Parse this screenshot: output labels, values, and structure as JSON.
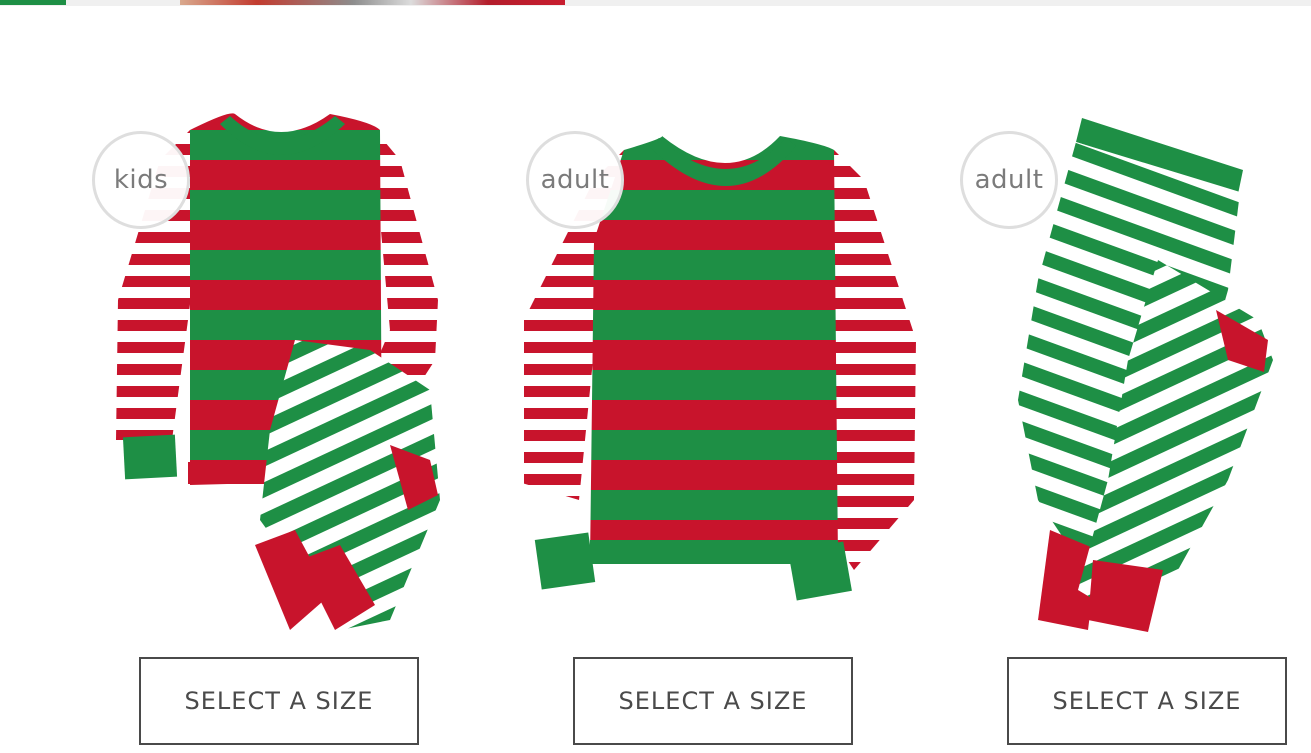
{
  "colors": {
    "green": "#1e8f45",
    "red": "#c8142c",
    "white": "#ffffff",
    "badge_text": "#7b7b7b",
    "button_border": "#4a4a4a"
  },
  "products": [
    {
      "badge": "kids",
      "garment": "kids pajama set (striped top and pants)",
      "button_label": "SELECT A SIZE"
    },
    {
      "badge": "adult",
      "garment": "adult striped pajama top",
      "button_label": "SELECT A SIZE"
    },
    {
      "badge": "adult",
      "garment": "adult striped pajama pants",
      "button_label": "SELECT A SIZE"
    }
  ]
}
